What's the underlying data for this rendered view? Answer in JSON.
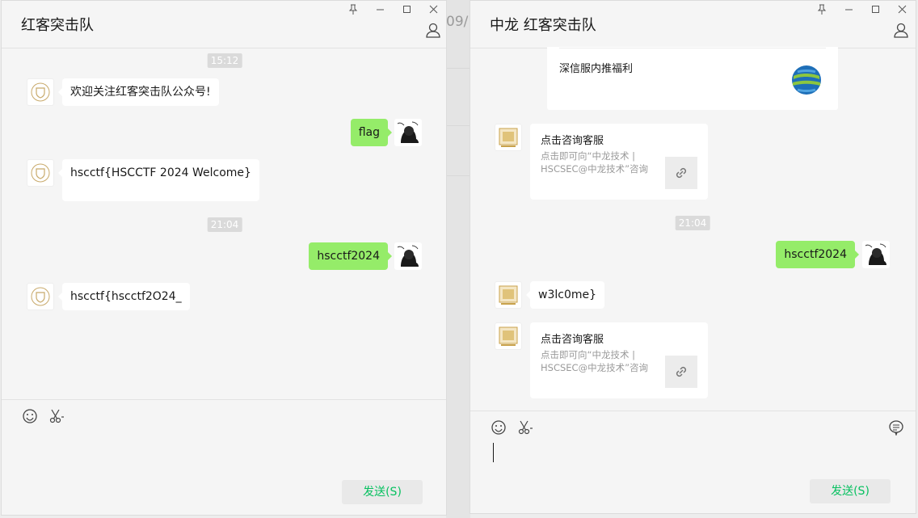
{
  "background": {
    "partial_text": "09/"
  },
  "left_window": {
    "title": "红客突击队",
    "messages": {
      "time1": "15:12",
      "msg1": "欢迎关注红客突击队公众号!",
      "msg2": "flag",
      "msg3": "hscctf{HSCCTF 2024 Welcome}",
      "time2": "21:04",
      "msg4": "hscctf2024",
      "msg5": "hscctf{hscctf2O24_"
    },
    "send_label": "发送(S)"
  },
  "right_window": {
    "title": "中龙 红客突击队",
    "messages": {
      "article_title": "深信服内推福利",
      "card1_title": "点击咨询客服",
      "card1_desc": "点击即可向“中龙技术 | HSCSEC@中龙技术”咨询",
      "time": "21:04",
      "msg_out": "hscctf2024",
      "msg_in": "w3lc0me}",
      "card2_title": "点击咨询客服",
      "card2_desc": "点击即可向“中龙技术 | HSCSEC@中龙技术”咨询"
    },
    "send_label": "发送(S)"
  },
  "icons": [
    "pin-icon",
    "minimize-icon",
    "maximize-icon",
    "close-icon",
    "user-profile-icon",
    "emoji-icon",
    "scissors-icon",
    "chat-history-icon",
    "link-icon"
  ],
  "colors": {
    "outgoing_bubble": "#95ec69",
    "send_text": "#07c160",
    "window_bg": "#f5f5f5"
  }
}
